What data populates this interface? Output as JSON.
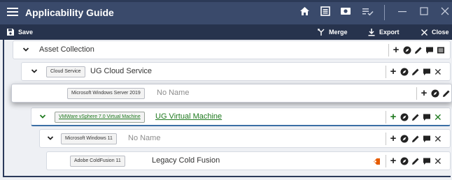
{
  "window": {
    "title": "Applicability Guide"
  },
  "toolbar": {
    "save_label": "Save",
    "merge_label": "Merge",
    "export_label": "Export",
    "close_label": "Close"
  },
  "tree": {
    "nodes": [
      {
        "tag": "",
        "name": "Asset Collection"
      },
      {
        "tag": "Cloud Service",
        "name": "UG Cloud Service"
      },
      {
        "tag": "Microsoft Windows Server 2019",
        "name": "No Name"
      },
      {
        "tag": "VMWare vSphere 7.0 Virtual Machine",
        "name": "UG Virtual Machine"
      },
      {
        "tag": "Microsoft Windows 11",
        "name": "No Name"
      },
      {
        "tag": "Adobe ColdFusion 11",
        "name": "Legacy Cold Fusion"
      }
    ]
  },
  "colors": {
    "titlebar": "#3a4a6b",
    "toolbar": "#27334d",
    "link_green": "#1f7a1f",
    "warning_orange": "#e65c00"
  },
  "icons": {
    "titlebar": [
      "home-icon",
      "list-icon",
      "image-icon",
      "checklist-icon",
      "minimize-icon",
      "maximize-icon",
      "close-icon"
    ],
    "node_actions": [
      "add-icon",
      "compass-icon",
      "edit-icon",
      "comment-icon",
      "delete-icon"
    ]
  }
}
